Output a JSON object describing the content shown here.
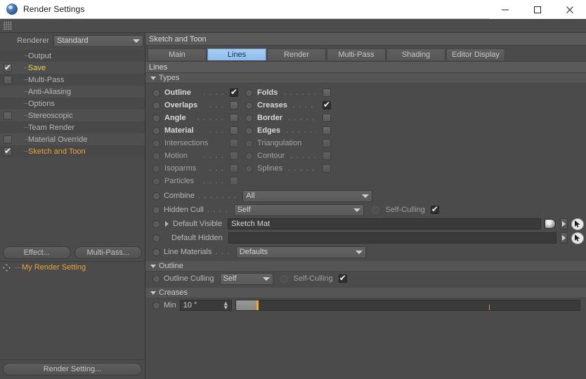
{
  "window": {
    "title": "Render Settings",
    "app_icon": "cinema4d-sphere-icon",
    "minimize": "minimize-icon",
    "maximize": "maximize-icon",
    "close": "close-icon"
  },
  "left_panel": {
    "renderer_label": "Renderer",
    "renderer_value": "Standard",
    "tree_items": [
      {
        "label": "Output",
        "checkbox": "none",
        "highlight": "none"
      },
      {
        "label": "Save",
        "checkbox": "checked",
        "highlight": "yellow"
      },
      {
        "label": "Multi-Pass",
        "checkbox": "unchecked",
        "highlight": "none"
      },
      {
        "label": "Anti-Aliasing",
        "checkbox": "none",
        "highlight": "none"
      },
      {
        "label": "Options",
        "checkbox": "none",
        "highlight": "none"
      },
      {
        "label": "Stereoscopic",
        "checkbox": "unchecked",
        "highlight": "none"
      },
      {
        "label": "Team Render",
        "checkbox": "none",
        "highlight": "none"
      },
      {
        "label": "Material Override",
        "checkbox": "unchecked",
        "highlight": "none"
      },
      {
        "label": "Sketch and Toon",
        "checkbox": "checked",
        "highlight": "orange"
      }
    ],
    "effect_button": "Effect...",
    "multipass_button": "Multi-Pass...",
    "setting_row_label": "My Render Setting",
    "setting_row_icon": "move-handle-icon",
    "render_setting_button": "Render Setting..."
  },
  "right_panel": {
    "panel_title": "Sketch and Toon",
    "tabs": [
      {
        "label": "Main",
        "active": false
      },
      {
        "label": "Lines",
        "active": true
      },
      {
        "label": "Render",
        "active": false
      },
      {
        "label": "Multi-Pass",
        "active": false
      },
      {
        "label": "Shading",
        "active": false
      },
      {
        "label": "Editor Display",
        "active": false
      }
    ],
    "section_header": "Lines",
    "groups": {
      "types": {
        "title": "Types",
        "expanded": true,
        "column_left": [
          {
            "label": "Outline",
            "dots": ". . . .",
            "checked": true,
            "bold": true
          },
          {
            "label": "Overlaps",
            "dots": ". . .",
            "checked": false,
            "bold": true
          },
          {
            "label": "Angle",
            "dots": ". . . . .",
            "checked": false,
            "bold": true
          },
          {
            "label": "Material",
            "dots": ". . .",
            "checked": false,
            "bold": true
          },
          {
            "label": "Intersections",
            "dots": "",
            "checked": false,
            "bold": false
          },
          {
            "label": "Motion",
            "dots": ". . . .",
            "checked": false,
            "bold": false
          },
          {
            "label": "Isoparms",
            "dots": ". . .",
            "checked": false,
            "bold": false
          },
          {
            "label": "Particles",
            "dots": ". . . .",
            "checked": false,
            "bold": false
          }
        ],
        "column_right": [
          {
            "label": "Folds",
            "dots": ". . . . . .",
            "checked": false,
            "bold": true
          },
          {
            "label": "Creases",
            "dots": ". . . . .",
            "checked": true,
            "bold": true
          },
          {
            "label": "Border",
            "dots": ". . . . . .",
            "checked": false,
            "bold": true
          },
          {
            "label": "Edges",
            "dots": ". . . . . .",
            "checked": false,
            "bold": true
          },
          {
            "label": "Triangulation",
            "dots": "",
            "checked": false,
            "bold": false
          },
          {
            "label": "Contour",
            "dots": ". . . . .",
            "checked": false,
            "bold": false
          },
          {
            "label": "Splines",
            "dots": ". . . . . .",
            "checked": false,
            "bold": false
          }
        ],
        "fields": {
          "combine_label": "Combine",
          "combine_dots": ". . . . . . .",
          "combine_value": "All",
          "hidden_cull_label": "Hidden Cull",
          "hidden_cull_dots": ". . . .",
          "hidden_cull_value": "Self",
          "hidden_cull_selfculling_label": "Self-Culling",
          "hidden_cull_selfculling_checked": true,
          "default_visible_label": "Default Visible",
          "default_visible_value": "Sketch Mat",
          "default_hidden_label": "Default Hidden",
          "default_hidden_value": "",
          "line_materials_label": "Line Materials",
          "line_materials_dots": ". . .",
          "line_materials_value": "Defaults",
          "material_thumb_icon": "material-sphere-icon",
          "expand_arrow_icon": "chevron-right-icon",
          "picker_icon": "cursor-picker-icon"
        }
      },
      "outline": {
        "title": "Outline",
        "expanded": true,
        "culling_label": "Outline Culling",
        "culling_value": "Self",
        "selfculling_label": "Self-Culling",
        "selfculling_checked": true
      },
      "creases": {
        "title": "Creases",
        "expanded": true,
        "min_label": "Min",
        "min_value": "10 °",
        "min_slider_percent": 6,
        "spinner_icon": "updown-arrows-icon"
      }
    }
  },
  "colors": {
    "accent_tab": "#8dbcec",
    "highlight_orange": "#e8a33d",
    "highlight_yellow": "#f0d24a",
    "slider_knob": "#f0a828",
    "panel_bg": "#4b4b4b",
    "header_bg": "#5a5a5a"
  }
}
